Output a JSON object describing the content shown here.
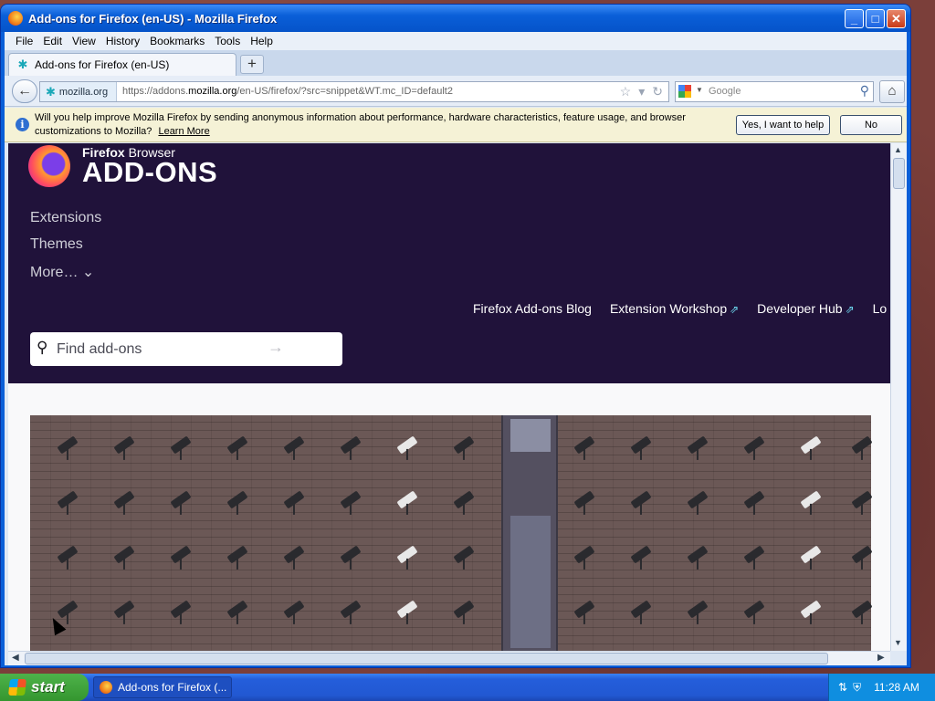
{
  "window": {
    "title": "Add-ons for Firefox (en-US) - Mozilla Firefox",
    "minimize_glyph": "_",
    "maximize_glyph": "□",
    "close_glyph": "✕"
  },
  "menubar": {
    "items": [
      "File",
      "Edit",
      "View",
      "History",
      "Bookmarks",
      "Tools",
      "Help"
    ]
  },
  "tabs": {
    "active_label": "Add-ons for Firefox (en-US)",
    "new_tab_glyph": "+"
  },
  "navbar": {
    "back_glyph": "←",
    "site_domain": "mozilla.org",
    "url_prefix": "https://addons.",
    "url_domain": "mozilla.org",
    "url_suffix": "/en-US/firefox/?src=snippet&WT.mc_ID=default2",
    "search_placeholder": "Google",
    "home_glyph": "⌂"
  },
  "notification": {
    "message": "Will you help improve Mozilla Firefox by sending anonymous information about performance, hardware characteristics, feature usage, and browser customizations to Mozilla?",
    "learn_more": "Learn More",
    "yes_label": "Yes, I want to help",
    "no_label": "No"
  },
  "page": {
    "brand_top_bold": "Firefox",
    "brand_top_rest": " Browser",
    "brand_main": "ADD-ONS",
    "nav_extensions": "Extensions",
    "nav_themes": "Themes",
    "nav_more": "More… ⌄",
    "links": {
      "blog": "Firefox Add-ons Blog",
      "workshop": "Extension Workshop",
      "devhub": "Developer Hub",
      "login": "Lo"
    },
    "external_glyph": "⇗",
    "search_placeholder": "Find add-ons",
    "search_go_glyph": "→"
  },
  "taskbar": {
    "start_label": "start",
    "task_label": "Add-ons for Firefox (...",
    "clock": "11:28 AM"
  }
}
